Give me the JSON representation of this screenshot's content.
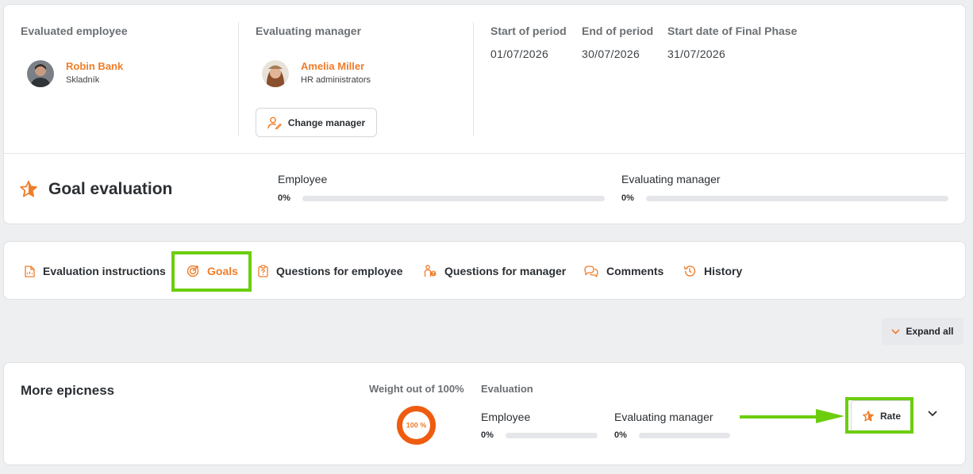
{
  "header": {
    "employee": {
      "label": "Evaluated employee",
      "name": "Robin Bank",
      "role": "Skladník"
    },
    "manager": {
      "label": "Evaluating manager",
      "name": "Amelia Miller",
      "role": "HR administrators",
      "change_label": "Change manager"
    },
    "dates": [
      {
        "label": "Start of period",
        "value": "01/07/2026"
      },
      {
        "label": "End of period",
        "value": "30/07/2026"
      },
      {
        "label": "Start date of Final Phase",
        "value": "31/07/2026"
      }
    ]
  },
  "goal_evaluation": {
    "title": "Goal evaluation",
    "icon": "star-icon",
    "progress": [
      {
        "label": "Employee",
        "percent_text": "0%",
        "value": 0
      },
      {
        "label": "Evaluating manager",
        "percent_text": "0%",
        "value": 0
      }
    ]
  },
  "tabs": [
    {
      "label": "Evaluation instructions",
      "icon": "document-icon"
    },
    {
      "label": "Goals",
      "icon": "target-icon",
      "active": true
    },
    {
      "label": "Questions for employee",
      "icon": "clipboard-icon"
    },
    {
      "label": "Questions for manager",
      "icon": "person-question-icon"
    },
    {
      "label": "Comments",
      "icon": "comments-icon"
    },
    {
      "label": "History",
      "icon": "history-icon"
    }
  ],
  "expand_all": {
    "label": "Expand all"
  },
  "goal": {
    "title": "More epicness",
    "weight_label": "Weight out of 100%",
    "weight_text": "100 %",
    "weight_value": 100,
    "evaluation_label": "Evaluation",
    "progress": [
      {
        "label": "Employee",
        "percent_text": "0%",
        "value": 0
      },
      {
        "label": "Evaluating manager",
        "percent_text": "0%",
        "value": 0
      }
    ],
    "rate_label": "Rate"
  },
  "colors": {
    "accent": "#ef7d2a",
    "highlight": "#6ccd0e",
    "text": "#2b2f33",
    "muted": "#6b6f73"
  }
}
